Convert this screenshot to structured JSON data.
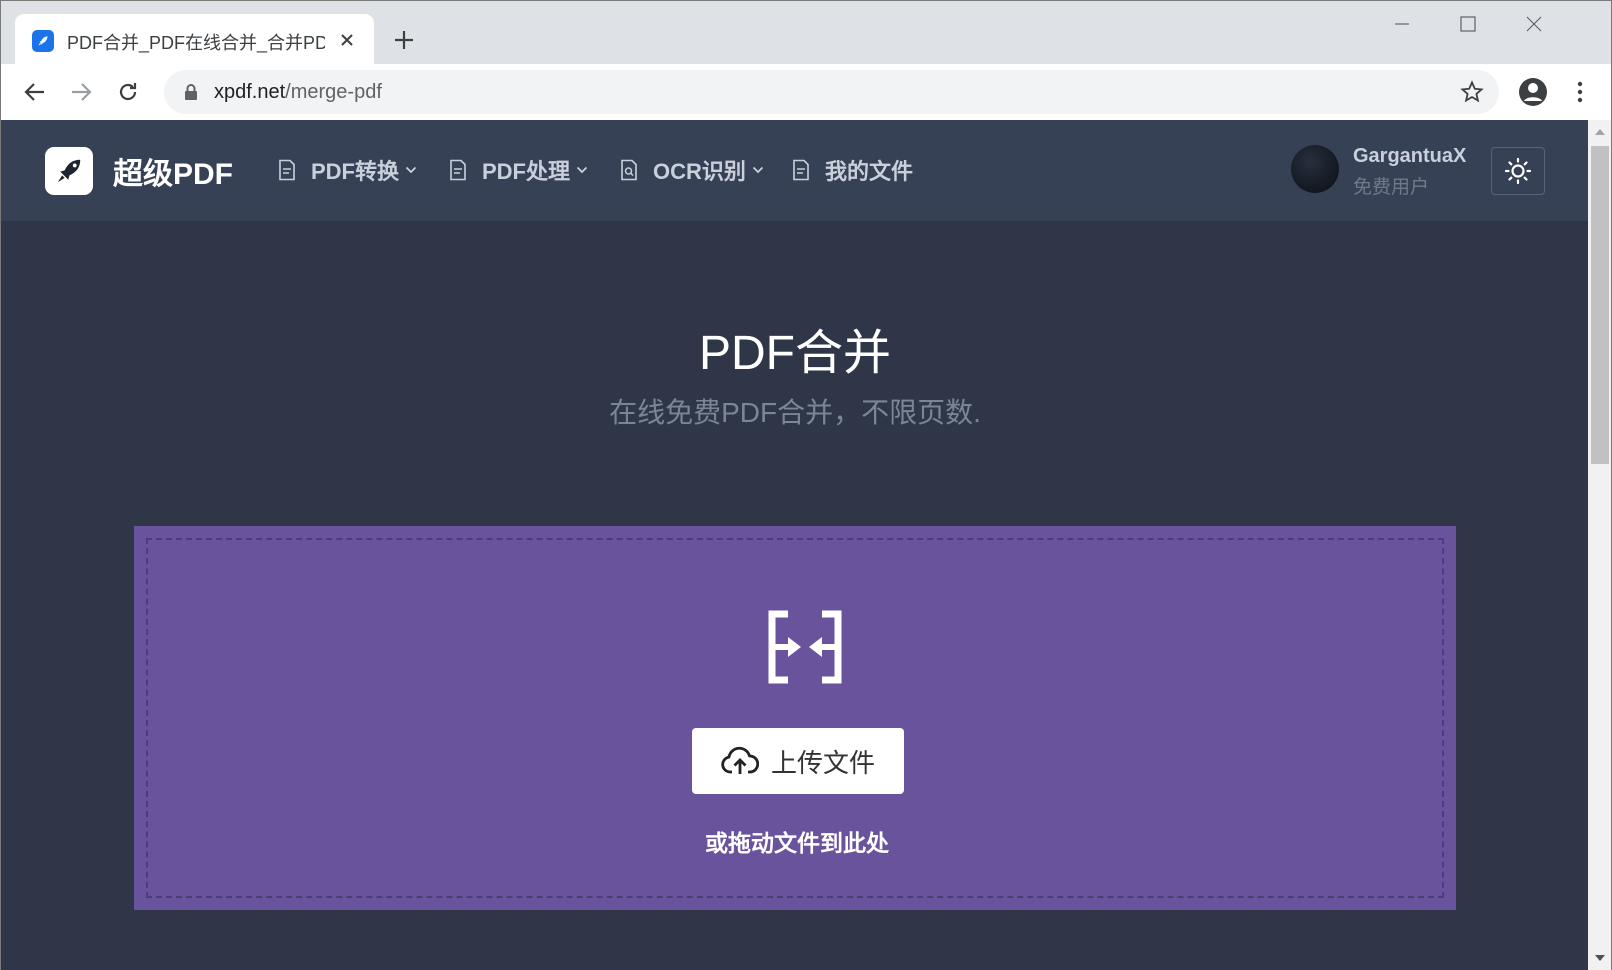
{
  "browser": {
    "tab_title": "PDF合并_PDF在线合并_合并PDF_",
    "url_host": "xpdf.net",
    "url_path": "/merge-pdf",
    "icons": [
      "rocket-favicon-icon",
      "close-icon",
      "plus-icon",
      "minimize-icon",
      "maximize-icon",
      "window-close-icon",
      "back-arrow-icon",
      "forward-arrow-icon",
      "reload-icon",
      "lock-icon",
      "star-icon",
      "account-icon",
      "more-vertical-icon"
    ]
  },
  "site": {
    "logo_text": "超级PDF",
    "nav": [
      {
        "label": "PDF转换",
        "has_dropdown": true
      },
      {
        "label": "PDF处理",
        "has_dropdown": true
      },
      {
        "label": "OCR识别",
        "has_dropdown": true
      },
      {
        "label": "我的文件",
        "has_dropdown": false
      }
    ],
    "user": {
      "name": "GargantuaX",
      "role": "免费用户"
    },
    "theme_icon": "sun-icon"
  },
  "hero": {
    "title": "PDF合并",
    "subtitle": "在线免费PDF合并，不限页数."
  },
  "dropzone": {
    "upload_label": "上传文件",
    "hint": "或拖动文件到此处",
    "icon": "merge-icon"
  },
  "colors": {
    "page_bg": "#2e3648",
    "header_bg": "#364155",
    "dropzone_bg": "#6a539d",
    "accent": "#1a73e8"
  }
}
